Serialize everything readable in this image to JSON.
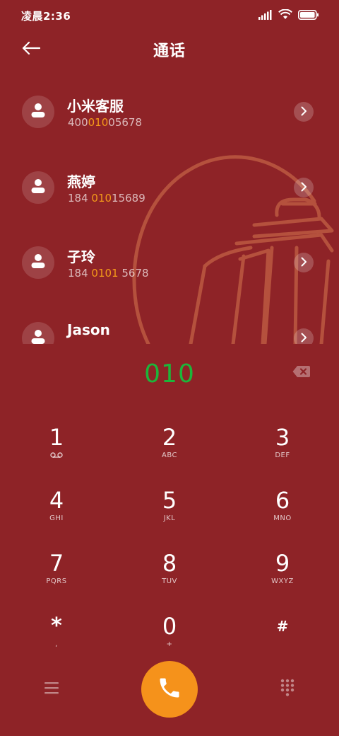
{
  "status_bar": {
    "time": "凌晨2:36",
    "icons": [
      "signal-icon",
      "wifi-icon",
      "battery-icon"
    ]
  },
  "header": {
    "title": "通话",
    "back_icon": "arrow-left-icon"
  },
  "contacts": [
    {
      "name": "小米客服",
      "number_parts": [
        "400",
        "010",
        "05678"
      ]
    },
    {
      "name": "燕婷",
      "number_parts": [
        "184 ",
        "010",
        "15689"
      ]
    },
    {
      "name": "子玲",
      "number_parts": [
        "184 ",
        "0101",
        " 5678"
      ]
    },
    {
      "name": "Jason",
      "number_parts": [
        "",
        "",
        ""
      ]
    }
  ],
  "dialer": {
    "digits": "010"
  },
  "keypad": [
    {
      "digit": "1",
      "sub": ""
    },
    {
      "digit": "2",
      "sub": "ABC"
    },
    {
      "digit": "3",
      "sub": "DEF"
    },
    {
      "digit": "4",
      "sub": "GHI"
    },
    {
      "digit": "5",
      "sub": "JKL"
    },
    {
      "digit": "6",
      "sub": "MNO"
    },
    {
      "digit": "7",
      "sub": "PQRS"
    },
    {
      "digit": "8",
      "sub": "TUV"
    },
    {
      "digit": "9",
      "sub": "WXYZ"
    },
    {
      "digit": "*",
      "sub": ","
    },
    {
      "digit": "0",
      "sub": "+"
    },
    {
      "digit": "#",
      "sub": ""
    }
  ],
  "colors": {
    "background": "#8e2327",
    "accent": "#f5921b",
    "highlight": "#f39a1a",
    "digits": "#1db53a"
  }
}
